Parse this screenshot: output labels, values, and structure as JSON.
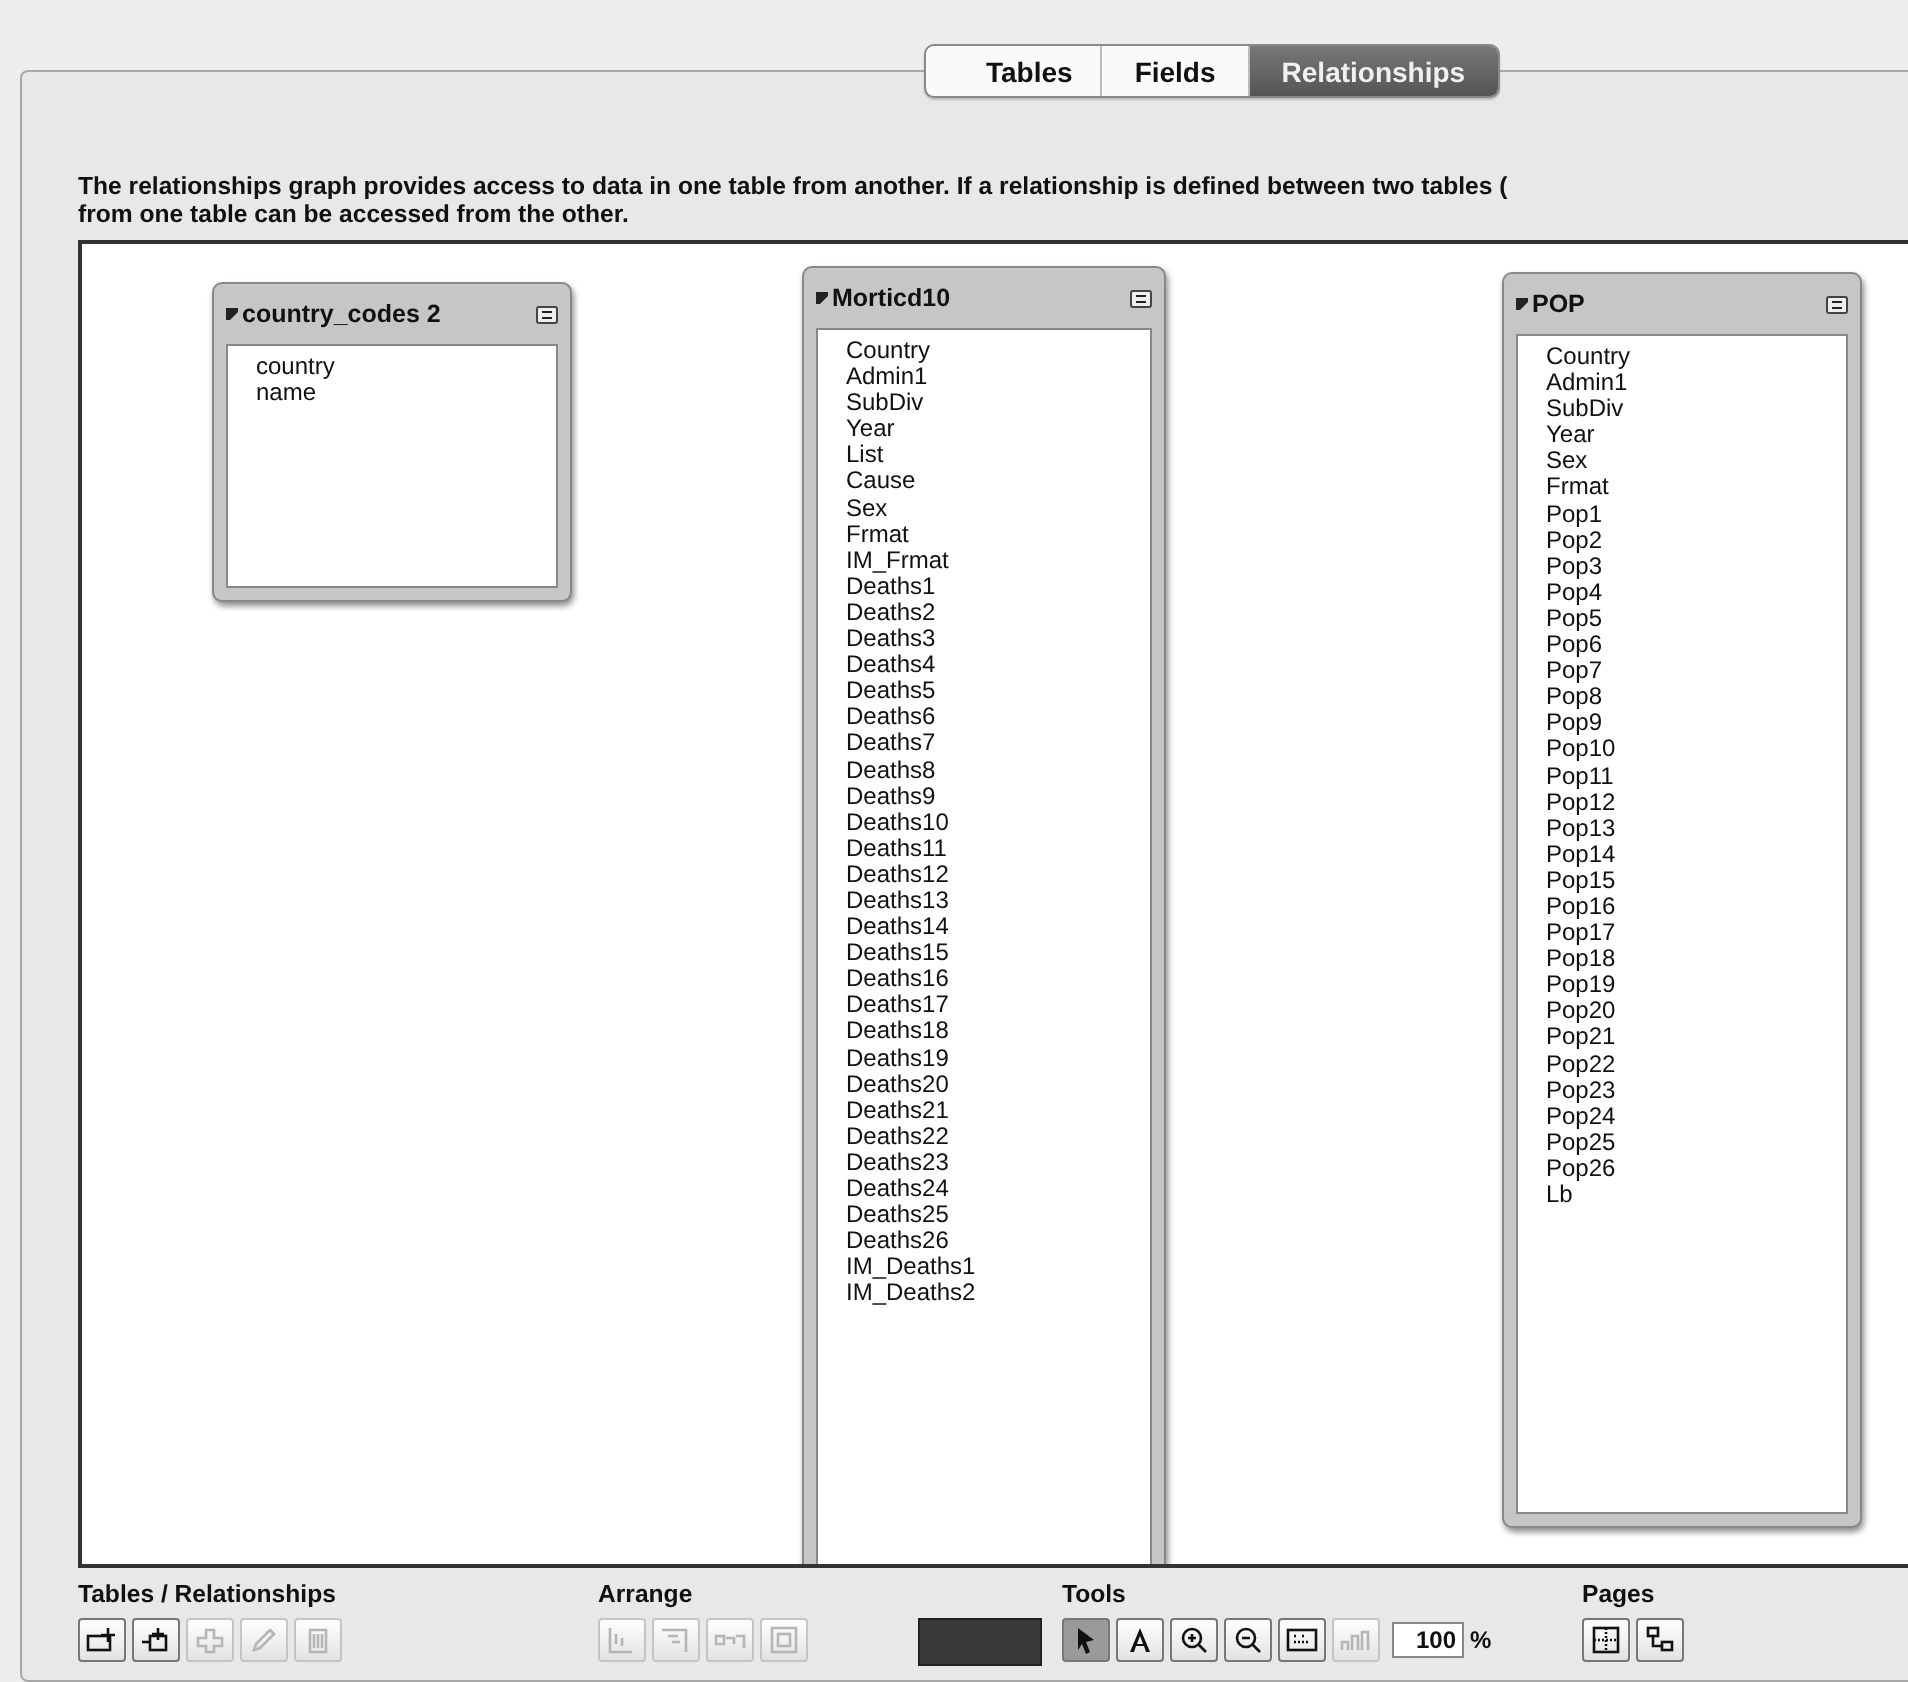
{
  "tabs": [
    {
      "label": "Tables",
      "selected": false
    },
    {
      "label": "Fields",
      "selected": false
    },
    {
      "label": "Relationships",
      "selected": true
    }
  ],
  "description": "The relationships graph provides access to data in one table from another. If a relationship is defined between two tables (",
  "description_line_2": "from one table can be accessed from the other.",
  "tables": [
    {
      "name": "country_codes 2",
      "fields": [
        "country",
        "name"
      ]
    },
    {
      "name": "Morticd10",
      "fields": [
        "Country",
        "Admin1",
        "SubDiv",
        "Year",
        "List",
        "Cause",
        "Sex",
        "Frmat",
        "IM_Frmat",
        "Deaths1",
        "Deaths2",
        "Deaths3",
        "Deaths4",
        "Deaths5",
        "Deaths6",
        "Deaths7",
        "Deaths8",
        "Deaths9",
        "Deaths10",
        "Deaths11",
        "Deaths12",
        "Deaths13",
        "Deaths14",
        "Deaths15",
        "Deaths16",
        "Deaths17",
        "Deaths18",
        "Deaths19",
        "Deaths20",
        "Deaths21",
        "Deaths22",
        "Deaths23",
        "Deaths24",
        "Deaths25",
        "Deaths26",
        "IM_Deaths1",
        "IM_Deaths2"
      ]
    },
    {
      "name": "POP",
      "fields": [
        "Country",
        "Admin1",
        "SubDiv",
        "Year",
        "Sex",
        "Frmat",
        "Pop1",
        "Pop2",
        "Pop3",
        "Pop4",
        "Pop5",
        "Pop6",
        "Pop7",
        "Pop8",
        "Pop9",
        "Pop10",
        "Pop11",
        "Pop12",
        "Pop13",
        "Pop14",
        "Pop15",
        "Pop16",
        "Pop17",
        "Pop18",
        "Pop19",
        "Pop20",
        "Pop21",
        "Pop22",
        "Pop23",
        "Pop24",
        "Pop25",
        "Pop26",
        "Lb"
      ]
    }
  ],
  "toolbar": [
    {
      "title": "Tables / Relationships",
      "items": [
        {
          "kind": "button",
          "disabled": false,
          "selected": false
        },
        {
          "kind": "button",
          "disabled": false,
          "selected": false
        },
        {
          "kind": "button",
          "disabled": true,
          "selected": false
        },
        {
          "kind": "button",
          "disabled": true,
          "selected": false
        },
        {
          "kind": "button",
          "disabled": true,
          "selected": false
        }
      ]
    },
    {
      "title": "Arrange",
      "items": [
        {
          "kind": "button",
          "disabled": true,
          "selected": false
        },
        {
          "kind": "button",
          "disabled": true,
          "selected": false
        },
        {
          "kind": "button",
          "disabled": true,
          "selected": false
        },
        {
          "kind": "button",
          "disabled": true,
          "selected": false
        }
      ]
    },
    {
      "items": [
        {
          "kind": "swatch"
        }
      ]
    },
    {
      "title": "Tools",
      "items": [
        {
          "kind": "button",
          "disabled": false,
          "selected": true
        },
        {
          "kind": "button",
          "disabled": false,
          "selected": false
        },
        {
          "kind": "button",
          "disabled": false,
          "selected": false
        },
        {
          "kind": "button",
          "disabled": false,
          "selected": false
        },
        {
          "kind": "button",
          "disabled": false,
          "selected": false
        },
        {
          "kind": "button",
          "disabled": true,
          "selected": false
        },
        {
          "kind": "field",
          "value": "100"
        },
        {
          "kind": "unit",
          "text": "%"
        }
      ]
    },
    {
      "title": "Pages",
      "items": [
        {
          "kind": "button",
          "disabled": false,
          "selected": false
        },
        {
          "kind": "button",
          "disabled": false,
          "selected": false
        }
      ]
    }
  ]
}
